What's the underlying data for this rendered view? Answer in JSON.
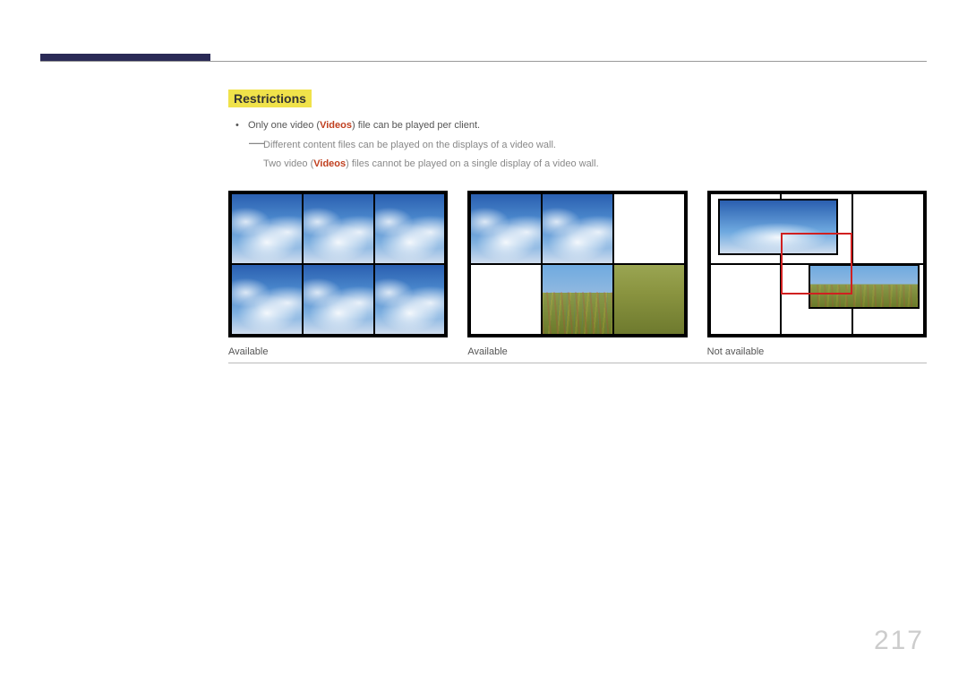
{
  "section_title": "Restrictions",
  "bullet": {
    "pre": "Only one video (",
    "em": "Videos",
    "post": ") file can be played per client."
  },
  "note": {
    "line1": "Different content files can be played on the displays of a video wall.",
    "line2_pre": "Two video (",
    "line2_em": "Videos",
    "line2_post": ") files cannot be played on a single display of a video wall."
  },
  "captions": [
    "Available",
    "Available",
    "Not available"
  ],
  "page_number": "217"
}
